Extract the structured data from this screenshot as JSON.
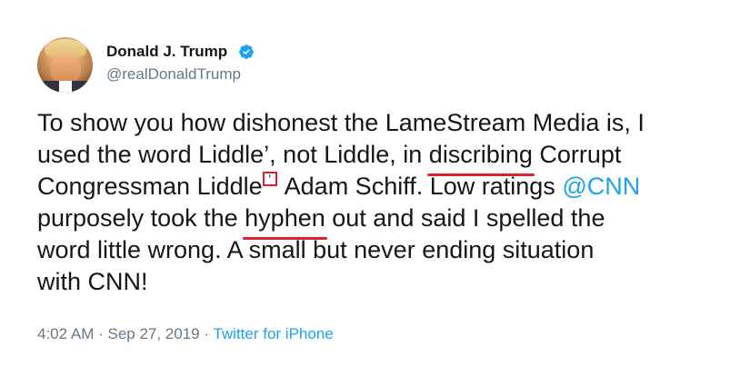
{
  "author": {
    "name": "Donald J. Trump",
    "handle": "@realDonaldTrump",
    "verified": true
  },
  "tweet": {
    "line1": "To show you how dishonest the LameStream Media is, I",
    "line2_pre": "used the word Liddle’, not Liddle, in ",
    "line2_underlined": "discribing",
    "line2_post": " Corrupt",
    "line3_pre": "Congressman Liddle",
    "line3_boxed": "’",
    "line3_mid": " Adam Schiff. Low ratings ",
    "line3_mention": "@CNN",
    "line4_pre": " purposely took the ",
    "line4_underlined": "hyphen",
    "line4_post": " out and said I spelled the",
    "line5": "word little wrong. A small but never ending situation",
    "line6": "with CNN!"
  },
  "meta": {
    "time": "4:02 AM",
    "date": "Sep 27, 2019",
    "source": "Twitter for iPhone"
  },
  "colors": {
    "accent": "#1da1f2",
    "annotation": "#e0202e",
    "secondary_text": "#657786"
  },
  "icons": {
    "verified": "verified-badge-icon"
  }
}
